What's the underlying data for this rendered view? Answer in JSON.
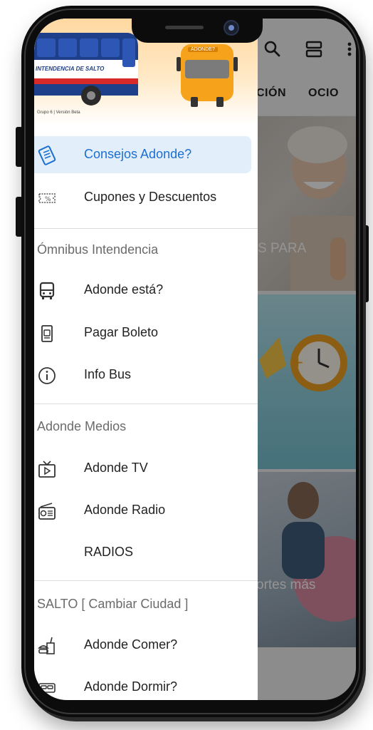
{
  "app": {
    "header": {
      "bus_banner_text": "INTENDENCIA DE SALTO",
      "bus_sign_text": "ADONDE?",
      "version_text": "Grupo 6 | Versión Beta"
    },
    "drawer": {
      "top_items": [
        {
          "label": "Consejos Adonde?",
          "icon": "tips-icon",
          "active": true
        },
        {
          "label": "Cupones y Descuentos",
          "icon": "coupon-icon",
          "active": false
        }
      ],
      "section_omnibus": "Ómnibus Intendencia",
      "omnibus_items": [
        {
          "label": "Adonde está?",
          "icon": "bus-icon"
        },
        {
          "label": "Pagar Boleto",
          "icon": "ticket-icon"
        },
        {
          "label": "Info Bus",
          "icon": "info-icon"
        }
      ],
      "section_medios": "Adonde Medios",
      "medios_items": [
        {
          "label": "Adonde TV",
          "icon": "tv-icon"
        },
        {
          "label": "Adonde Radio",
          "icon": "radio-icon"
        },
        {
          "label": "RADIOS",
          "icon": ""
        }
      ],
      "section_city": "SALTO [ Cambiar Ciudad ]",
      "city_items": [
        {
          "label": "Adonde Comer?",
          "icon": "food-icon"
        },
        {
          "label": "Adonde Dormir?",
          "icon": "bed-icon"
        }
      ]
    },
    "background": {
      "tab_partial": "CIÓN",
      "tab_ocio": "OCIO",
      "card1_text": "S PARA",
      "card3_text": "ortes más"
    }
  },
  "colors": {
    "accent": "#1b6fd1",
    "active_bg": "#e3eefb",
    "bus_orange": "#f7a21b",
    "bus_blue": "#1e3f8a"
  }
}
